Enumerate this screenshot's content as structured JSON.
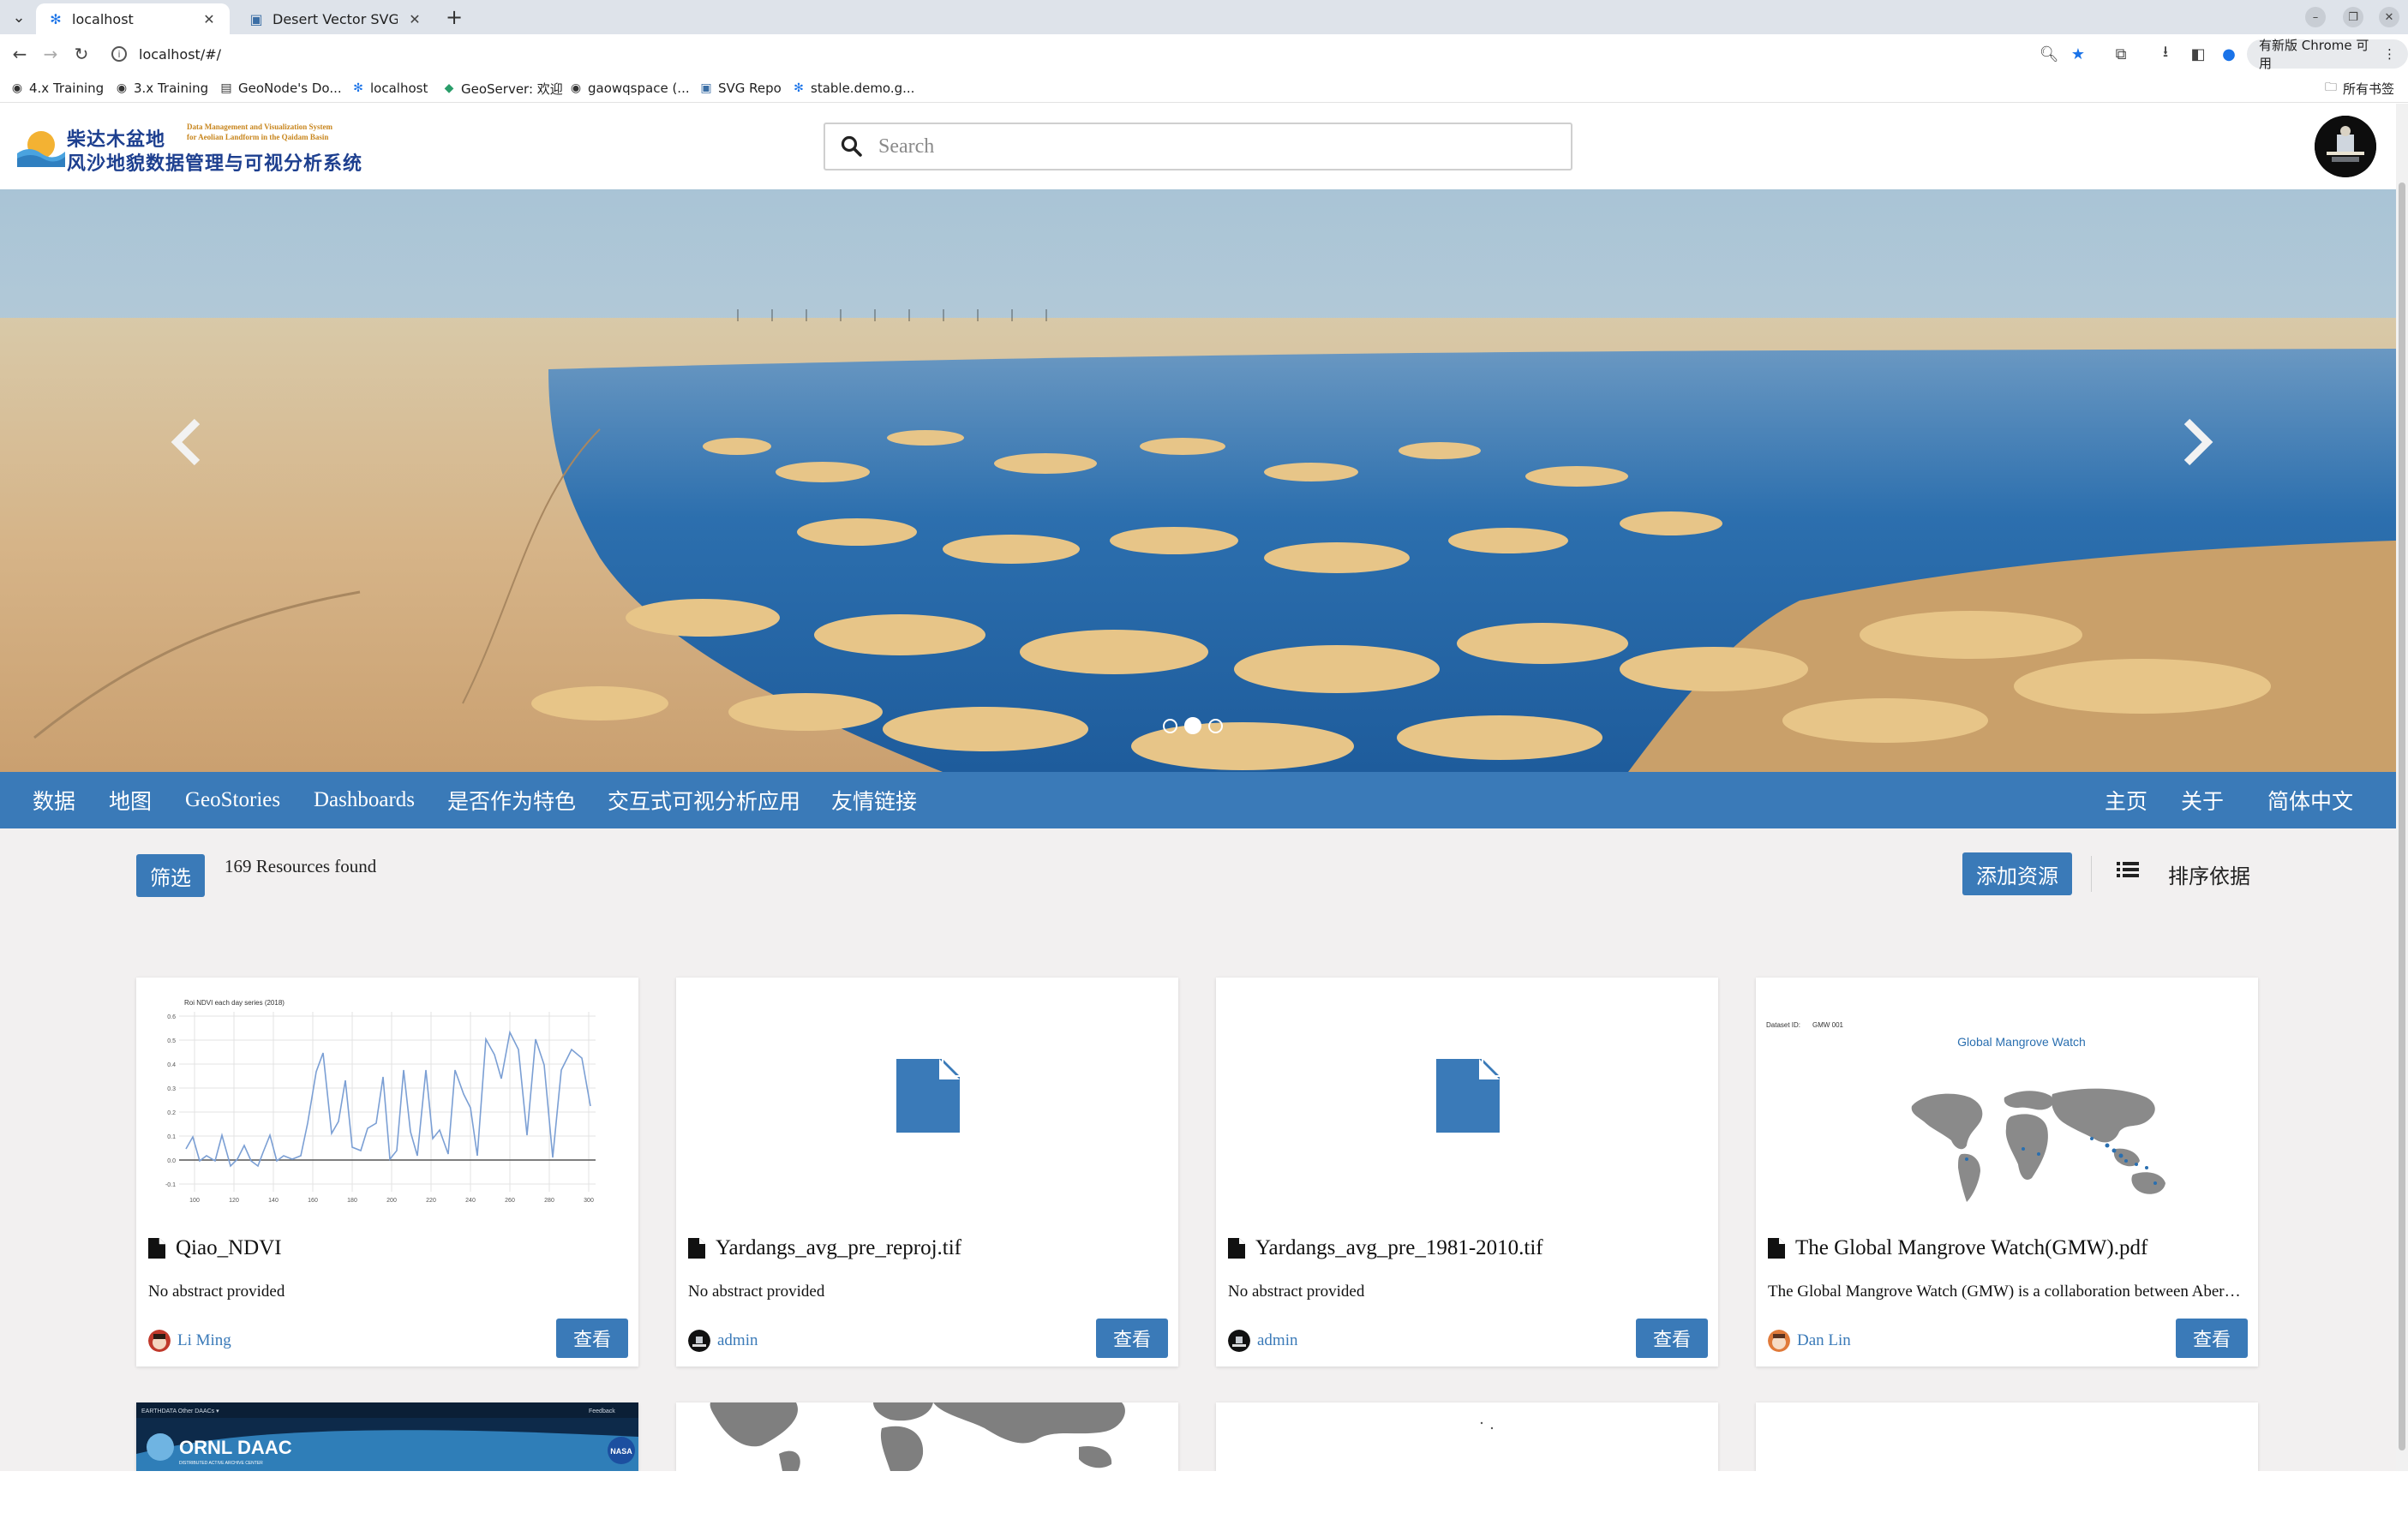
{
  "browser": {
    "tabs": [
      {
        "title": "localhost",
        "active": true
      },
      {
        "title": "Desert Vector SVG Icon (",
        "active": false
      }
    ],
    "url": "localhost/#/",
    "update_chip": "有新版 Chrome 可用",
    "bookmarks": [
      "4.x Training",
      "3.x Training",
      "GeoNode's Do...",
      "localhost",
      "GeoServer: 欢迎",
      "gaowqspace (...",
      "SVG Repo",
      "stable.demo.g..."
    ],
    "all_bookmarks": "所有书签"
  },
  "site": {
    "logo": {
      "cn_line1": "柴达木盆地",
      "cn_line2": "风沙地貌数据管理与可视分析系统",
      "en_line1": "Data Management and Visualization System",
      "en_line2": "for Aeolian Landform in the Qaidam Basin"
    },
    "search_placeholder": "Search"
  },
  "carousel": {
    "slides": 3,
    "active_index": 1
  },
  "nav": {
    "left": [
      "数据",
      "地图",
      "GeoStories",
      "Dashboards",
      "是否作为特色",
      "交互式可视分析应用",
      "友情链接"
    ],
    "right": [
      "主页",
      "关于",
      "简体中文"
    ]
  },
  "filters": {
    "filter_label": "筛选",
    "count_text": "169 Resources found",
    "add_resource": "添加资源",
    "sort_label": "排序依据"
  },
  "cards": [
    {
      "title": "Qiao_NDVI",
      "abstract": "No abstract provided",
      "owner": "Li Ming",
      "view_label": "查看",
      "thumb": "chart"
    },
    {
      "title": "Yardangs_avg_pre_reproj.tif",
      "abstract": "No abstract provided",
      "owner": "admin",
      "view_label": "查看",
      "thumb": "file"
    },
    {
      "title": "Yardangs_avg_pre_1981-2010.tif",
      "abstract": "No abstract provided",
      "owner": "admin",
      "view_label": "查看",
      "thumb": "file"
    },
    {
      "title": "The Global Mangrove Watch(GMW).pdf",
      "abstract": "The Global Mangrove Watch (GMW) is a collaboration between Aberystwyth University",
      "owner": "Dan Lin",
      "view_label": "查看",
      "thumb": "map"
    }
  ],
  "ndvi_thumb": {
    "title": "Roi NDVI each day series (2018)",
    "y_ticks": [
      "0.6",
      "0.5",
      "0.4",
      "0.3",
      "0.2",
      "0.1",
      "0.0",
      "-0.1"
    ],
    "x_ticks": [
      "100",
      "120",
      "140",
      "160",
      "180",
      "200",
      "220",
      "240",
      "260",
      "280",
      "300"
    ]
  },
  "gmw_thumb": {
    "dataset_id": "Dataset ID:",
    "dataset_code": "GMW 001",
    "title": "Global Mangrove Watch"
  },
  "next_row": {
    "ornl_bar_left": "EARTHDATA   Other DAACs ▾",
    "ornl_bar_right": "Feedback",
    "ornl_title": "ORNL DAAC",
    "ornl_sub": "DISTRIBUTED ACTIVE ARCHIVE CENTER",
    "nasa": "NASA"
  },
  "colors": {
    "primary": "#3a7ab8",
    "page_bg": "#f2f0f0"
  }
}
